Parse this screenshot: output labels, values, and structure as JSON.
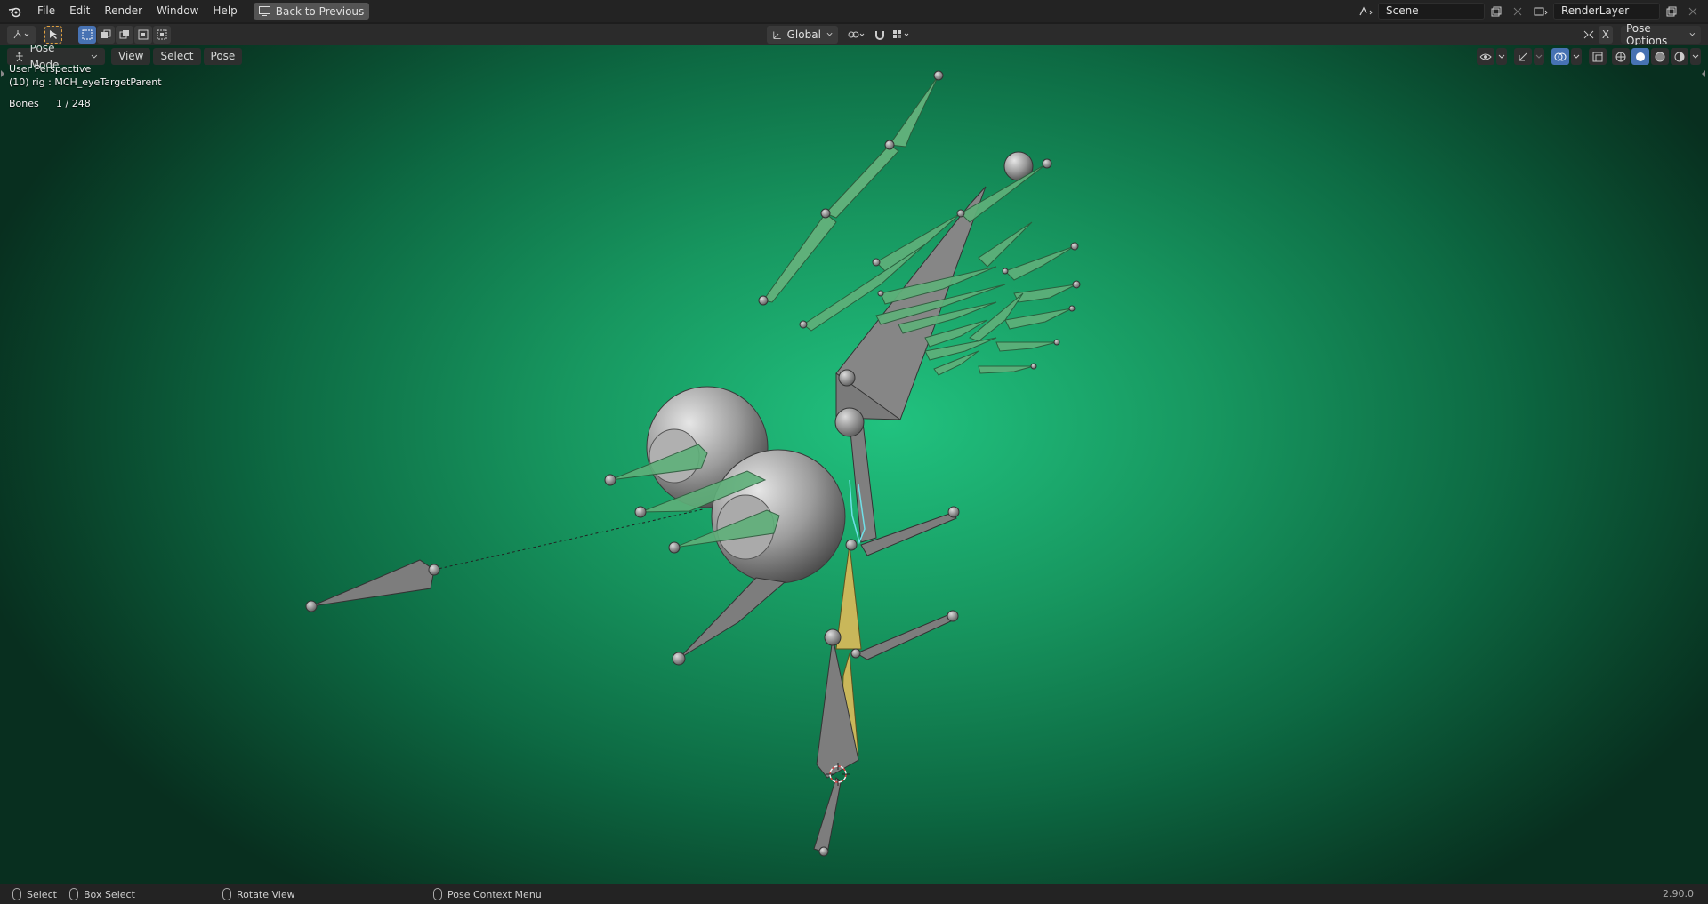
{
  "topbar": {
    "menus": [
      "File",
      "Edit",
      "Render",
      "Window",
      "Help"
    ],
    "back_button": "Back to Previous",
    "scene_field": "Scene",
    "layer_field": "RenderLayer"
  },
  "toolbar": {
    "orientation": "Global",
    "pose_options": "Pose Options",
    "x_label": "X"
  },
  "viewport": {
    "mode": "Pose Mode",
    "menus": [
      "View",
      "Select",
      "Pose"
    ],
    "perspective": "User Perspective",
    "active": "(10) rig : MCH_eyeTargetParent",
    "bones_label": "Bones",
    "bones_count": "1 / 248"
  },
  "statusbar": {
    "select": "Select",
    "box_select": "Box Select",
    "rotate": "Rotate View",
    "context": "Pose Context Menu",
    "version": "2.90.0"
  },
  "colors": {
    "viewport_center": "#21c27f",
    "bone_green": "#5fb07a",
    "bone_gray": "#8a8a8a",
    "bone_selected": "#c9b75a",
    "accent": "#4772b3"
  }
}
